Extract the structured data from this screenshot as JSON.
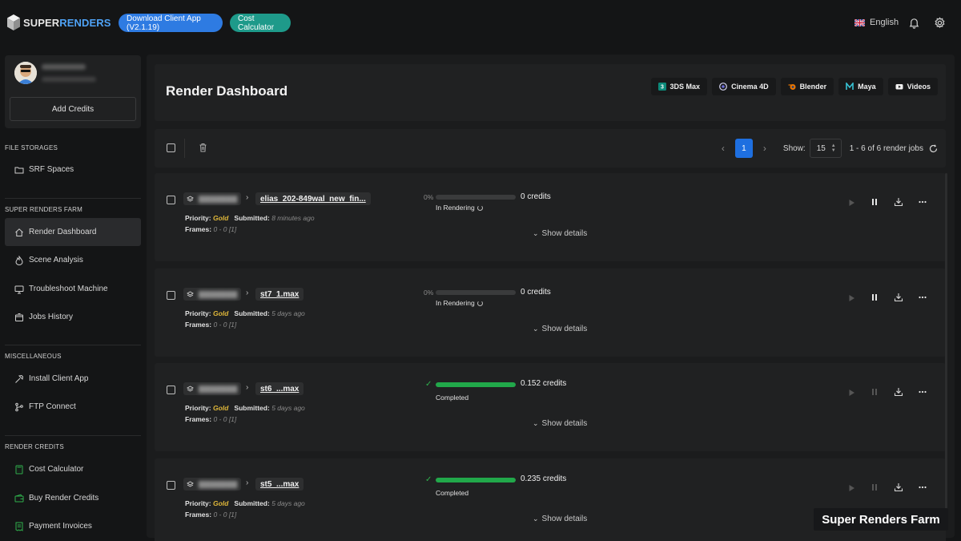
{
  "header": {
    "logo": {
      "part1": "SUPER",
      "part2": "RENDERS"
    },
    "download_button": "Download Client App (V2.1.19)",
    "cost_button": "Cost Calculator",
    "language": "English"
  },
  "sidebar": {
    "add_credits": "Add Credits",
    "sections": [
      {
        "title": "FILE STORAGES",
        "items": [
          {
            "label": "SRF Spaces",
            "icon": "folder-icon"
          }
        ]
      },
      {
        "title": "SUPER RENDERS FARM",
        "items": [
          {
            "label": "Render Dashboard",
            "icon": "home-icon",
            "active": true
          },
          {
            "label": "Scene Analysis",
            "icon": "flame-icon"
          },
          {
            "label": "Troubleshoot Machine",
            "icon": "monitor-icon"
          },
          {
            "label": "Jobs History",
            "icon": "box-icon"
          }
        ]
      },
      {
        "title": "MISCELLANEOUS",
        "items": [
          {
            "label": "Install Client App",
            "icon": "hammer-icon"
          },
          {
            "label": "FTP Connect",
            "icon": "git-branch-icon"
          }
        ]
      },
      {
        "title": "RENDER CREDITS",
        "items": [
          {
            "label": "Cost Calculator",
            "icon": "calculator-icon"
          },
          {
            "label": "Buy Render Credits",
            "icon": "wallet-icon"
          },
          {
            "label": "Payment Invoices",
            "icon": "invoice-icon"
          }
        ]
      }
    ]
  },
  "main": {
    "title": "Render Dashboard",
    "software_tabs": [
      "3DS Max",
      "Cinema 4D",
      "Blender",
      "Maya",
      "Videos"
    ],
    "pagination": {
      "current_page": "1",
      "show_label": "Show:",
      "page_size": "15",
      "summary": "1 - 6 of 6 render jobs"
    },
    "labels": {
      "priority": "Priority:",
      "submitted": "Submitted:",
      "frames": "Frames:",
      "show_details": "Show details",
      "credits_unit": "credits"
    },
    "jobs": [
      {
        "name": "elias_202-849wal_new_fin...",
        "priority": "Gold",
        "submitted": "8 minutes ago",
        "frames": "0 - 0 [1]",
        "percent_label": "0%",
        "progress": 0,
        "status": "In Rendering",
        "credits": "0",
        "completed": false
      },
      {
        "name": "st7_1.max",
        "priority": "Gold",
        "submitted": "5 days ago",
        "frames": "0 - 0 [1]",
        "percent_label": "0%",
        "progress": 0,
        "status": "In Rendering",
        "credits": "0",
        "completed": false
      },
      {
        "name": "st6_...max",
        "priority": "Gold",
        "submitted": "5 days ago",
        "frames": "0 - 0 [1]",
        "percent_label": "",
        "progress": 1,
        "status": "Completed",
        "credits": "0.152",
        "completed": true
      },
      {
        "name": "st5_...max",
        "priority": "Gold",
        "submitted": "5 days ago",
        "frames": "0 - 0 [1]",
        "percent_label": "",
        "progress": 1,
        "status": "Completed",
        "credits": "0.235",
        "completed": true
      }
    ]
  },
  "watermark": "Super Renders Farm",
  "colors": {
    "primary_blue": "#2e7be2",
    "teal": "#1e9a8a",
    "gold": "#e0b83a",
    "success_green": "#21a84a",
    "background": "#141516"
  }
}
